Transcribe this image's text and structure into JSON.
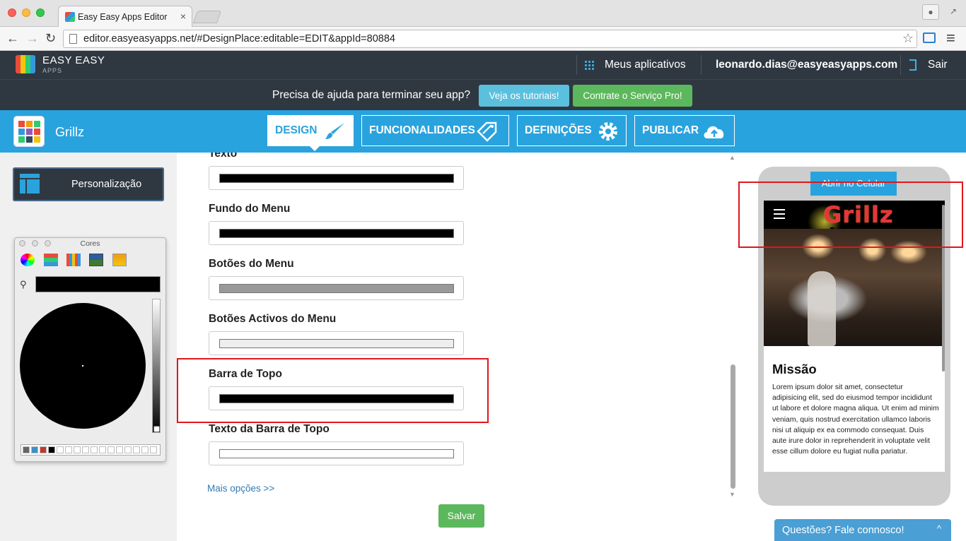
{
  "browser": {
    "tab_title": "Easy Easy Apps Editor",
    "tab_close": "×",
    "url": "editor.easyeasyapps.net/#DesignPlace:editable=EDIT&appId=80884",
    "back": "←",
    "forward": "→",
    "reload": "↻",
    "star": "☆",
    "menu": "≡"
  },
  "header": {
    "logo_main": "EASY EASY",
    "logo_sub": "APPS",
    "my_apps": "Meus aplicativos",
    "user_email": "leonardo.dias@easyeasyapps.com",
    "logout": "Sair"
  },
  "helpbar": {
    "text": "Precisa de ajuda para terminar seu app?",
    "tutorials_btn": "Veja os tutoriais!",
    "pro_btn": "Contrate o Serviço Pro!"
  },
  "toolbar": {
    "app_name": "Grillz",
    "tabs": [
      {
        "label": "DESIGN"
      },
      {
        "label": "FUNCIONALIDADES"
      },
      {
        "label": "DEFINIÇÕES"
      },
      {
        "label": "PUBLICAR"
      }
    ]
  },
  "sidebar": {
    "personalization": "Personalização",
    "color_picker_title": "Cores"
  },
  "form": {
    "fields": [
      {
        "label": "Texto",
        "color": "#000000"
      },
      {
        "label": "Fundo do Menu",
        "color": "#000000"
      },
      {
        "label": "Botões do Menu",
        "color": "#999999"
      },
      {
        "label": "Botões Activos do Menu",
        "color": "#eeeeee"
      },
      {
        "label": "Barra de Topo",
        "color": "#000000"
      },
      {
        "label": "Texto da Barra de Topo",
        "color": "#ffffff"
      }
    ],
    "more_options": "Mais opções >>",
    "save": "Salvar"
  },
  "preview": {
    "open_on_phone": "Abrir no Celular",
    "app_logo": "Grillz",
    "heading": "Missão",
    "body": "Lorem ipsum dolor sit amet, consectetur adipisicing elit, sed do eiusmod tempor incididunt ut labore et dolore magna aliqua. Ut enim ad minim veniam, quis nostrud exercitation ullamco laboris nisi ut aliquip ex ea commodo consequat. Duis aute irure dolor in reprehenderit in voluptate velit esse cillum dolore eu fugiat nulla pariatur."
  },
  "chat": {
    "label": "Questões? Fale connosco!",
    "chevron": "^"
  },
  "colors": {
    "accent": "#29a3de",
    "dark": "#2f3841",
    "success": "#5cb85c",
    "info": "#5bc0de",
    "highlight": "#e0161c"
  }
}
